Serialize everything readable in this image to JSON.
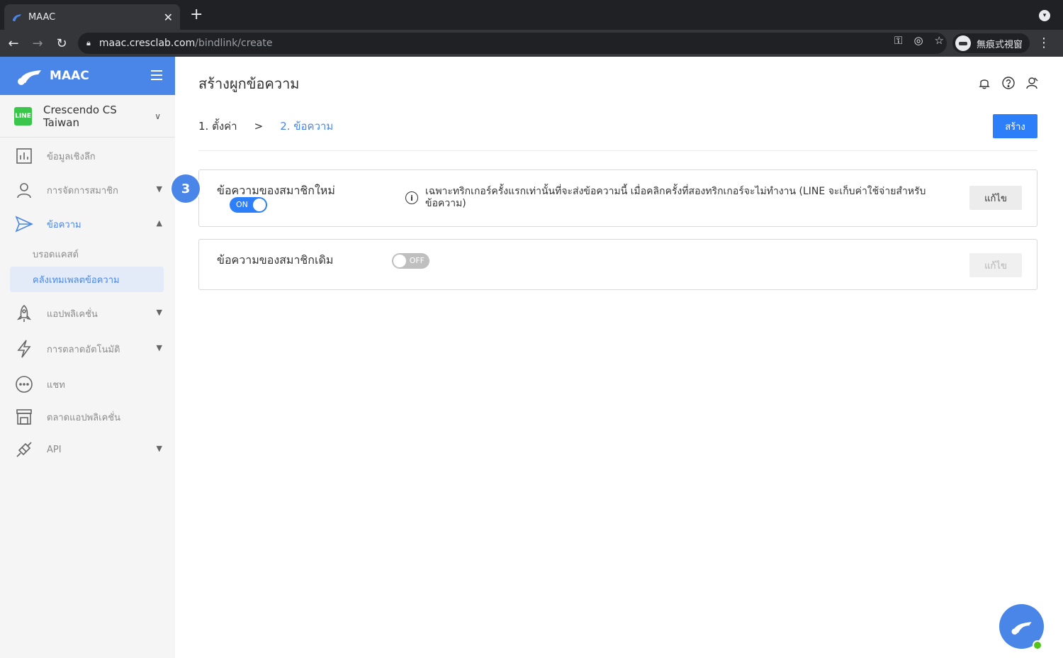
{
  "browser": {
    "tab_title": "MAAC",
    "tab_close": "✕",
    "new_tab": "+",
    "url_host": "maac.cresclab.com",
    "url_path": "/bindlink/create",
    "incognito_label": "無痕式視窗"
  },
  "sidebar": {
    "brand": "MAAC",
    "account_name": "Crescendo CS Taiwan",
    "account_badge": "LINE",
    "items": [
      {
        "label": "ข้อมูลเชิงลึก",
        "icon": "chart-icon"
      },
      {
        "label": "การจัดการสมาชิก",
        "icon": "user-icon"
      },
      {
        "label": "ข้อความ",
        "icon": "send-icon"
      },
      {
        "label": "แอปพลิเคชั่น",
        "icon": "rocket-icon"
      },
      {
        "label": "การตลาดอัตโนมัติ",
        "icon": "lightning-icon"
      },
      {
        "label": "แชท",
        "icon": "chat-bubble-icon"
      },
      {
        "label": "ตลาดแอปพลิเคชั่น",
        "icon": "store-icon"
      },
      {
        "label": "API",
        "icon": "plug-icon"
      }
    ],
    "subitems": [
      {
        "label": "บรอดแคสต์"
      },
      {
        "label": "คลังเทมเพลตข้อความ"
      }
    ]
  },
  "step_badge": "3",
  "main": {
    "title": "สร้างผูกข้อความ",
    "breadcrumb": {
      "step1": "1. ตั้งค่า",
      "separator": ">",
      "step2": "2. ข้อความ"
    },
    "create_button": "สร้าง",
    "new_member_card": {
      "title": "ข้อความของสมาชิกใหม่",
      "toggle_label": "ON",
      "info_icon": "i",
      "info_text": "เฉพาะทริกเกอร์ครั้งแรกเท่านั้นที่จะส่งข้อความนี้ เมื่อคลิกครั้งที่สองทริกเกอร์จะไม่ทำงาน (LINE จะเก็บค่าใช้จ่ายสำหรับข้อความ)",
      "edit_button": "แก้ไข"
    },
    "existing_member_card": {
      "title": "ข้อความของสมาชิกเดิม",
      "toggle_label": "OFF",
      "edit_button": "แก้ไข"
    }
  },
  "colors": {
    "brand_blue": "#4a86e8",
    "primary_button": "#2d7ff9",
    "online_green": "#52c41a"
  }
}
